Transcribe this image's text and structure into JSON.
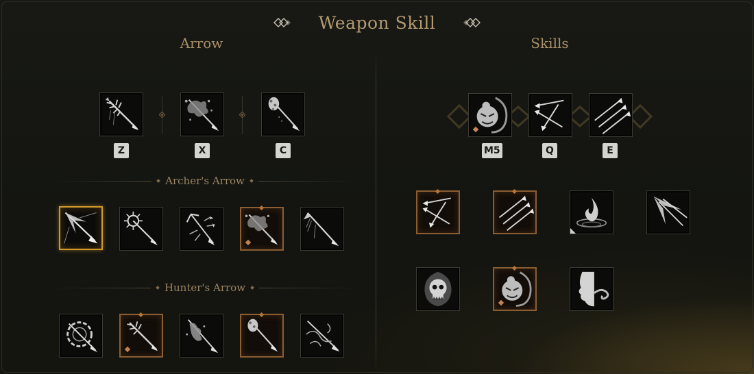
{
  "header": {
    "title": "Weapon Skill"
  },
  "arrow": {
    "heading": "Arrow",
    "keys": [
      "Z",
      "X",
      "C"
    ],
    "archers_label": "Archer's Arrow",
    "hunters_label": "Hunter's Arrow"
  },
  "skills": {
    "heading": "Skills",
    "keys": [
      "M5",
      "Q",
      "E"
    ]
  },
  "colors": {
    "title": "#b39a72",
    "selected_border": "#d39a2c",
    "equipped_border": "#8a5d32"
  }
}
